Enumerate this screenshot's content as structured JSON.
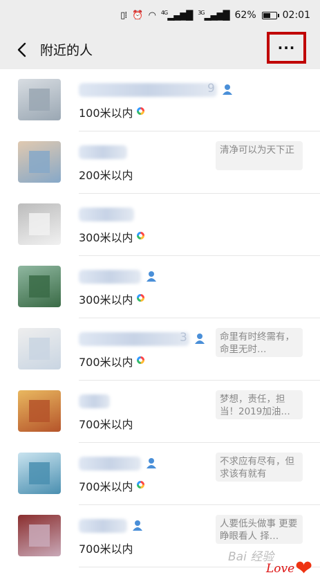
{
  "status_bar": {
    "icons": [
      "vibrate-icon",
      "alarm-icon",
      "wifi-icon",
      "signal-4g-icon",
      "signal-3g-icon"
    ],
    "net1": "4G",
    "net2": "3G",
    "battery_level": 0.62,
    "battery": "62%",
    "time": "02:01"
  },
  "header": {
    "back_icon": "chevron-left-icon",
    "title": "附近的人",
    "more": "···"
  },
  "people": [
    {
      "name_suffix": "9",
      "gender": true,
      "distance": "100米以内",
      "moments": true,
      "signature": "",
      "avatar_colors": [
        "#9aa7b3",
        "#d8dde2"
      ]
    },
    {
      "name_suffix": "",
      "gender": false,
      "distance": "200米以内",
      "moments": false,
      "signature": "清净可以为天下正",
      "avatar_colors": [
        "#86a8c8",
        "#e0c9b0"
      ]
    },
    {
      "name_suffix": "",
      "gender": false,
      "distance": "300米以内",
      "moments": true,
      "signature": "",
      "avatar_colors": [
        "#f1f1f1",
        "#bcbcbc"
      ]
    },
    {
      "name_suffix": "",
      "gender": true,
      "distance": "300米以内",
      "moments": true,
      "signature": "",
      "avatar_colors": [
        "#3a6b46",
        "#8fb7a0"
      ]
    },
    {
      "name_suffix": "3",
      "gender": true,
      "distance": "700米以内",
      "moments": true,
      "signature": "命里有时终需有，命里无时…",
      "avatar_colors": [
        "#c9d5e2",
        "#eeeeee"
      ]
    },
    {
      "name_suffix": "",
      "gender": false,
      "distance": "700米以内",
      "moments": false,
      "signature": "梦想，责任，担当！2019加油…",
      "avatar_colors": [
        "#b5542a",
        "#e9b860"
      ]
    },
    {
      "name_suffix": "",
      "gender": true,
      "distance": "700米以内",
      "moments": true,
      "signature": "不求应有尽有，但求该有就有",
      "avatar_colors": [
        "#4a8fb0",
        "#c9e3ef"
      ]
    },
    {
      "name_suffix": "",
      "gender": true,
      "distance": "700米以内",
      "moments": false,
      "signature": "人要低头做事 更要睁眼看人 择…",
      "avatar_colors": [
        "#c9a9b8",
        "#8a2e2e"
      ]
    }
  ],
  "watermark": {
    "text": "Bai 经验",
    "love": "Love"
  },
  "colors": {
    "header_bg": "#ededed",
    "highlight_border": "#c00000",
    "gender_male": "#4a8fd8"
  }
}
